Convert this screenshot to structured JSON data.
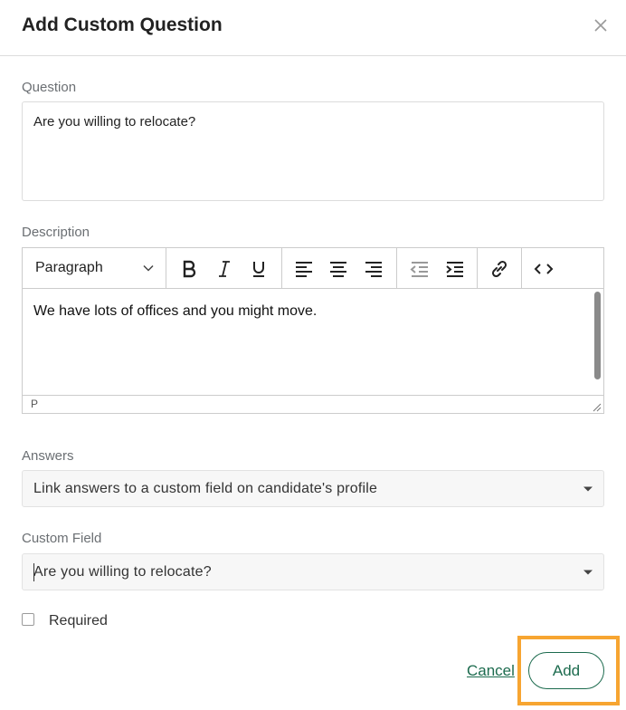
{
  "dialog": {
    "title": "Add Custom Question",
    "close_icon": "close-icon"
  },
  "question": {
    "label": "Question",
    "value": "Are you willing to relocate?"
  },
  "description": {
    "label": "Description",
    "toolbar": {
      "block_format": "Paragraph",
      "buttons": [
        "bold-icon",
        "italic-icon",
        "underline-icon",
        "align-left-icon",
        "align-center-icon",
        "align-right-icon",
        "outdent-icon",
        "indent-icon",
        "link-icon",
        "code-icon"
      ]
    },
    "content": "We have lots of offices and you might move.",
    "element_path": "P"
  },
  "answers": {
    "label": "Answers",
    "selected": "Link answers to a custom field on candidate's profile"
  },
  "custom_field": {
    "label": "Custom Field",
    "selected": "Are you willing to relocate?"
  },
  "required": {
    "label": "Required",
    "checked": false
  },
  "footer": {
    "cancel_label": "Cancel",
    "add_label": "Add"
  },
  "colors": {
    "accent": "#1c6b4e",
    "highlight": "#f7a531"
  }
}
